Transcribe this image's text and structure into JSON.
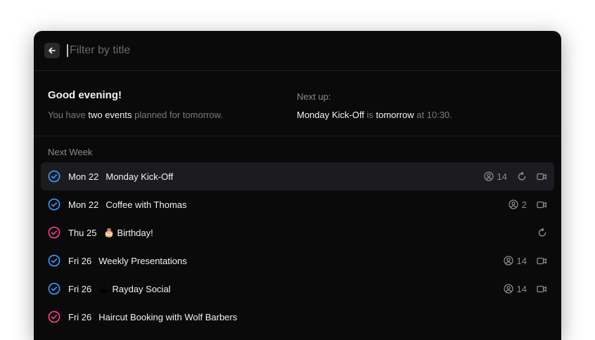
{
  "search": {
    "placeholder": "Filter by title"
  },
  "summary": {
    "greeting": "Good evening!",
    "line_prefix": "You have ",
    "line_highlight": "two events",
    "line_suffix": " planned for tomorrow.",
    "next_up_label": "Next up:",
    "next_event": "Monday Kick-Off",
    "next_mid": " is ",
    "next_when": "tomorrow",
    "next_time": " at 10:30."
  },
  "section": {
    "label": "Next Week"
  },
  "colors": {
    "work_calendar": "#3d9bff",
    "personal_calendar": "#ff3d8a",
    "window_bg": "#0a0a0b",
    "selected_row": "#1c1c20"
  },
  "events": [
    {
      "date": "Mon 22",
      "emoji": "",
      "title": "Monday Kick-Off",
      "attendees": "14",
      "recurring": true,
      "video": true,
      "calendar": "work",
      "selected": true
    },
    {
      "date": "Mon 22",
      "emoji": "",
      "title": "Coffee with Thomas",
      "attendees": "2",
      "recurring": false,
      "video": true,
      "calendar": "work",
      "selected": false
    },
    {
      "date": "Thu 25",
      "emoji": "🎂",
      "title": "Birthday!",
      "attendees": "",
      "recurring": true,
      "video": false,
      "calendar": "personal",
      "selected": false
    },
    {
      "date": "Fri 26",
      "emoji": "",
      "title": "Weekly Presentations",
      "attendees": "14",
      "recurring": false,
      "video": true,
      "calendar": "work",
      "selected": false
    },
    {
      "date": "Fri 26",
      "emoji": "🕹",
      "title": "Rayday Social",
      "attendees": "14",
      "recurring": false,
      "video": true,
      "calendar": "work",
      "selected": false
    },
    {
      "date": "Fri 26",
      "emoji": "",
      "title": "Haircut Booking with Wolf Barbers",
      "attendees": "",
      "recurring": false,
      "video": false,
      "calendar": "personal",
      "selected": false
    }
  ]
}
